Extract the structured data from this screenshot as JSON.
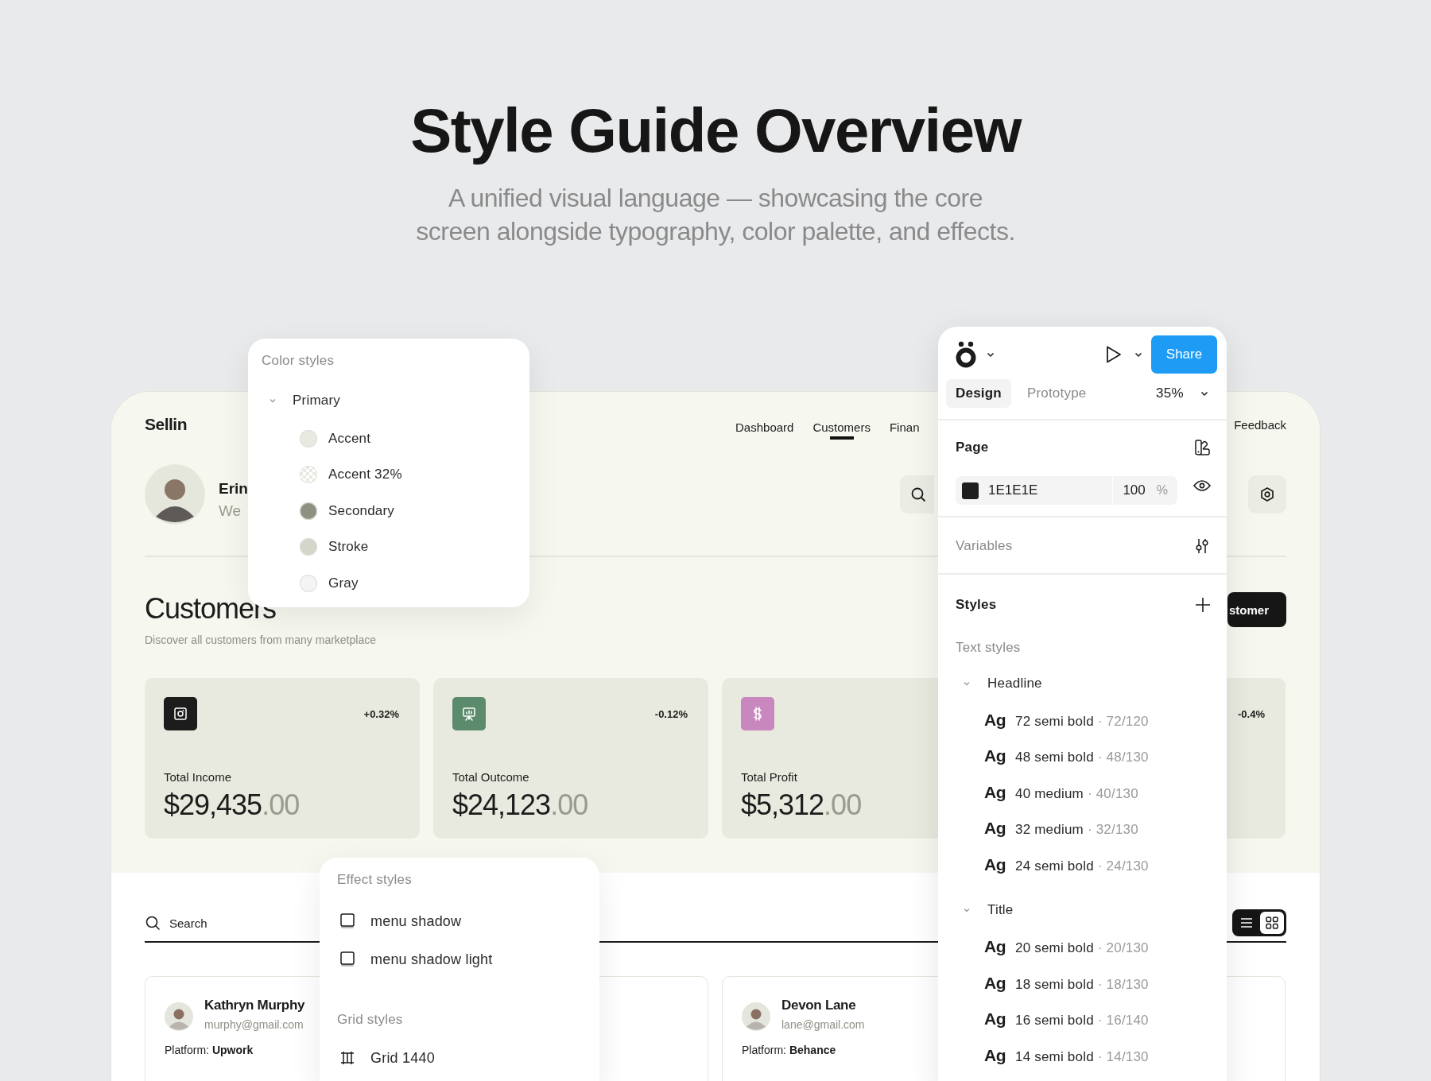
{
  "heading": {
    "title": "Style Guide Overview",
    "subtitle": "A unified visual language — showcasing the core screen alongside typography, color palette, and effects."
  },
  "dashboard": {
    "brand": "Sellin",
    "nav": [
      {
        "label": "Dashboard",
        "selected": false
      },
      {
        "label": "Customers",
        "selected": true
      },
      {
        "label": "Finan",
        "selected": false
      }
    ],
    "feedback": "Feedback",
    "profile": {
      "name": "Erin",
      "greeting": "We"
    },
    "page_title": "Customers",
    "page_subtitle": "Discover all customers from many marketplace",
    "add_button": "stomer",
    "stats": [
      {
        "kind": "image",
        "color": "#1c1c1c",
        "change": "+0.32%",
        "label": "Total Income",
        "amount": "$29,435",
        "cents": ".00"
      },
      {
        "kind": "presentation",
        "color": "#5b8a6c",
        "change": "-0.12%",
        "label": "Total Outcome",
        "amount": "$24,123",
        "cents": ".00"
      },
      {
        "kind": "dollar",
        "color": "#c987c0",
        "label": "Total Profit",
        "amount": "$5,312",
        "cents": ".00"
      },
      {
        "change": "-0.4%"
      }
    ],
    "search": {
      "placeholder": "Search"
    },
    "view_toggle": [
      {
        "kind": "list",
        "selected": false
      },
      {
        "kind": "grid",
        "selected": true
      }
    ],
    "customers": [
      {
        "name": "Kathryn Murphy",
        "email": "murphy@gmail.com",
        "platform": "Platform: **Upwork**"
      },
      {
        "name": "Devon Lane",
        "email": "lane@gmail.com",
        "platform": "Platform: **Behance**"
      }
    ]
  },
  "color_styles": {
    "title": "Color styles",
    "groups": [
      {
        "name": "Primary",
        "expanded": true,
        "items": [
          {
            "name": "Accent",
            "kind": "solid",
            "color": "#e8e9e0"
          },
          {
            "name": "Accent 32%",
            "kind": "checker",
            "color": "#e8e9e0"
          },
          {
            "name": "Secondary",
            "kind": "solid",
            "color": "#8e9082"
          },
          {
            "name": "Stroke",
            "kind": "solid",
            "color": "#d4d6ca"
          },
          {
            "name": "Gray",
            "kind": "solid",
            "color": "#f4f4f4"
          }
        ]
      }
    ]
  },
  "design_panel": {
    "share": "Share",
    "tabs": [
      {
        "label": "Design",
        "selected": true
      },
      {
        "label": "Prototype",
        "selected": false
      }
    ],
    "zoom": "35%",
    "page_label": "Page",
    "fill": {
      "hex": "1E1E1E",
      "opacity": "100",
      "unit": "%"
    },
    "variables": "Variables",
    "styles": "Styles",
    "text_styles_label": "Text styles",
    "text_style_groups": [
      {
        "name": "Headline",
        "expanded": true,
        "items": [
          {
            "sample": "Ag",
            "name": "72 semi bold",
            "spec": "· 72/120"
          },
          {
            "sample": "Ag",
            "name": "48 semi bold",
            "spec": "· 48/130"
          },
          {
            "sample": "Ag",
            "name": "40 medium",
            "spec": "· 40/130"
          },
          {
            "sample": "Ag",
            "name": "32 medium",
            "spec": "· 32/130"
          },
          {
            "sample": "Ag",
            "name": "24 semi bold",
            "spec": "· 24/130"
          }
        ]
      },
      {
        "name": "Title",
        "expanded": true,
        "items": [
          {
            "sample": "Ag",
            "name": "20 semi bold",
            "spec": "· 20/130"
          },
          {
            "sample": "Ag",
            "name": "18 semi bold",
            "spec": "· 18/130"
          },
          {
            "sample": "Ag",
            "name": "16 semi bold",
            "spec": "· 16/140"
          },
          {
            "sample": "Ag",
            "name": "14 semi bold",
            "spec": "· 14/130"
          }
        ]
      }
    ]
  },
  "effect_styles": {
    "title": "Effect styles",
    "effects": [
      "menu shadow",
      "menu shadow light"
    ],
    "grid_title": "Grid styles",
    "grids": [
      "Grid 1440"
    ]
  }
}
